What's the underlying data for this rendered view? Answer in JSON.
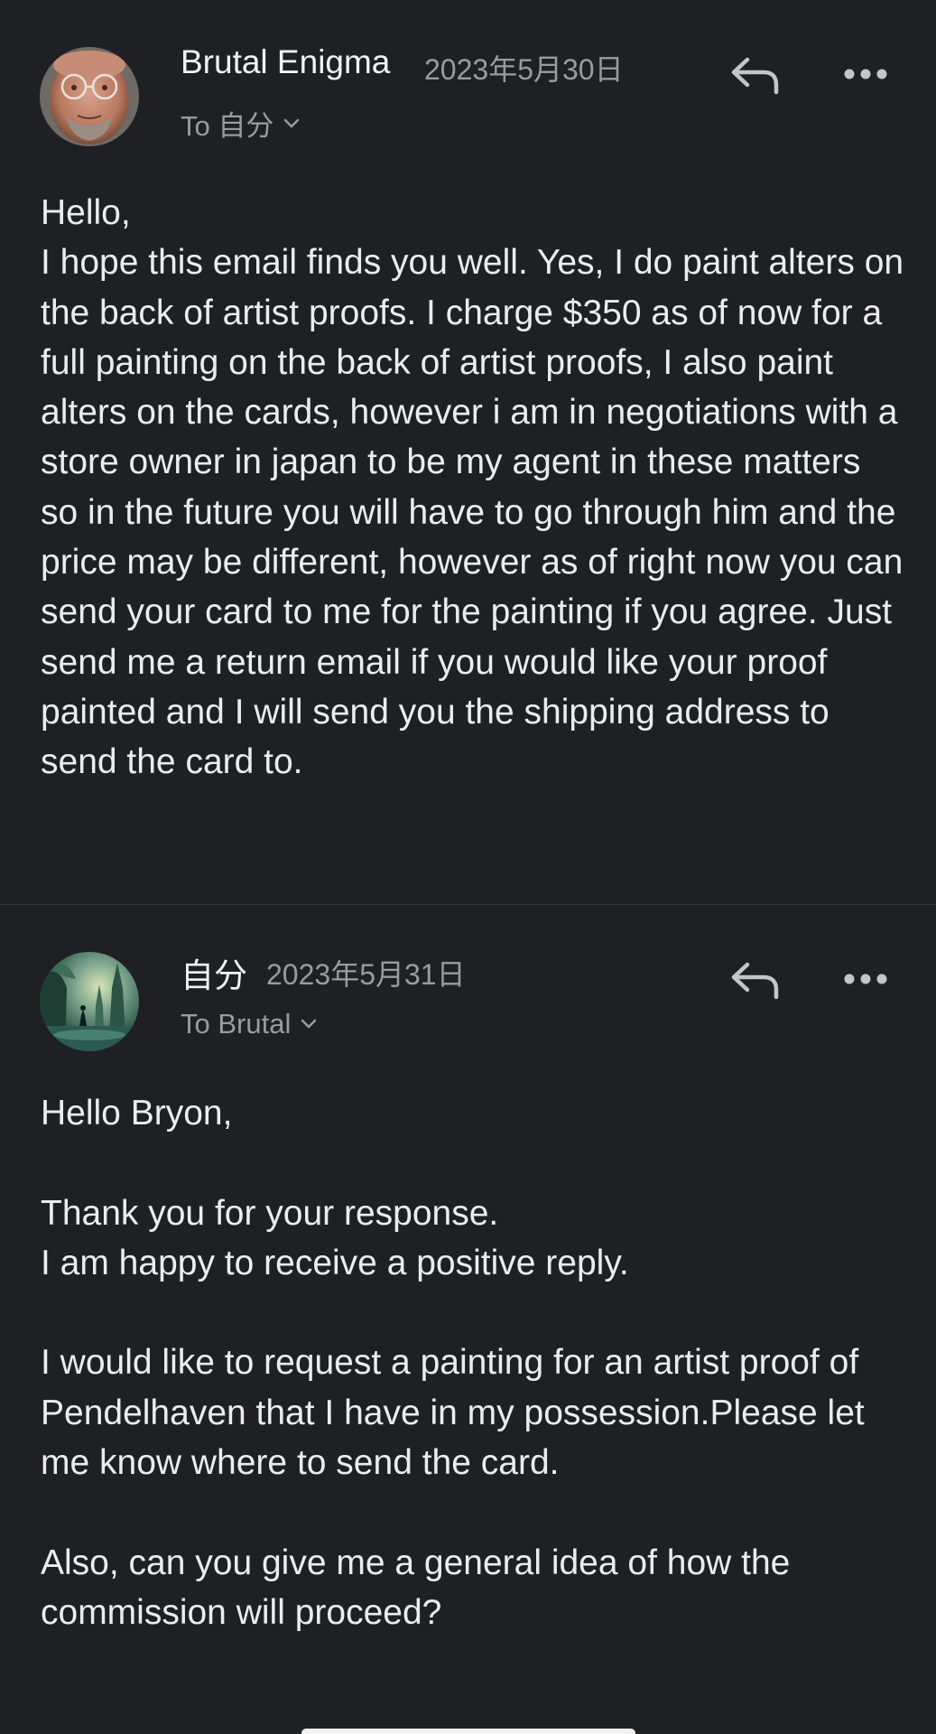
{
  "messages": [
    {
      "sender": "Brutal Enigma",
      "date": "2023年5月30日",
      "recipient": "To 自分",
      "avatar_icon": "person-portrait-avatar",
      "body": "Hello,\nI hope this email finds you well. Yes, I do paint alters on the back of artist proofs. I charge $350 as of now for a full painting on the back of artist proofs, I also paint alters on the cards, however i am in negotiations with a store owner in japan to be my agent in these matters so in the future you will have to go through him and the price may be different, however as of right now you can send your card to me for the painting if you agree. Just send me a return email if you would like your proof painted and I will send you the shipping address to send the card to."
    },
    {
      "sender": "自分",
      "date": "2023年5月31日",
      "recipient": "To Brutal",
      "avatar_icon": "forest-painting-avatar",
      "body": "Hello Bryon,\n\nThank you for your response.\nI am happy to receive a positive reply.\n\nI would like to request a painting for an artist proof of Pendelhaven that I have in my possession.Please let me know where to send the card.\n\nAlso, can you give me a general idea of how the commission will proceed?"
    }
  ],
  "icons": {
    "reply": "reply-arrow-icon",
    "more": "more-options-icon",
    "chevron": "chevron-down-icon"
  },
  "colors": {
    "background": "#1f2024",
    "text": "#ececf0",
    "muted": "#9a9ba1",
    "divider": "#3a3b40"
  }
}
